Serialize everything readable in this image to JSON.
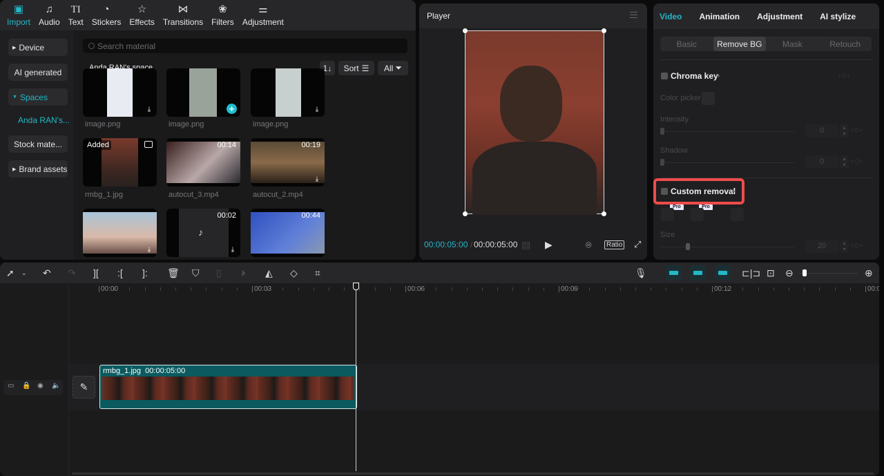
{
  "media_tabs": [
    {
      "label": "Import",
      "icon": "import-icon",
      "active": true
    },
    {
      "label": "Audio",
      "icon": "audio-icon"
    },
    {
      "label": "Text",
      "icon": "text-icon"
    },
    {
      "label": "Stickers",
      "icon": "stickers-icon"
    },
    {
      "label": "Effects",
      "icon": "effects-icon"
    },
    {
      "label": "Transitions",
      "icon": "transitions-icon"
    },
    {
      "label": "Filters",
      "icon": "filters-icon"
    },
    {
      "label": "Adjustment",
      "icon": "adjustment-icon"
    }
  ],
  "sidebar": {
    "device": "Device",
    "ai_generated": "AI generated",
    "spaces": "Spaces",
    "space_link": "Anda RAN's...",
    "stock": "Stock mate...",
    "brand": "Brand assets"
  },
  "search": {
    "placeholder": "Search material"
  },
  "space_title": "Anda RAN's space",
  "toolbar": {
    "order": "1↓",
    "sort": "Sort",
    "all": "All"
  },
  "cards": [
    {
      "name": "image.png",
      "download": true
    },
    {
      "name": "image.png",
      "add": true
    },
    {
      "name": "image.png",
      "download": true
    },
    {
      "name": "rmbg_1.jpg",
      "badge": "Added"
    },
    {
      "name": "autocut_3.mp4",
      "duration": "00:14"
    },
    {
      "name": "autocut_2.mp4",
      "duration": "00:19",
      "download": true
    },
    {
      "name": "",
      "download": true
    },
    {
      "name": "",
      "duration": "00:02",
      "download": true
    },
    {
      "name": "",
      "duration": "00:44"
    }
  ],
  "player": {
    "title": "Player",
    "current_time": "00:00:05:00",
    "total_time": "00:00:05:00",
    "ratio": "Ratio"
  },
  "props": {
    "tabs": [
      "Video",
      "Animation",
      "Adjustment",
      "AI stylize"
    ],
    "active_tab": "Video",
    "subtabs": [
      "Basic",
      "Remove BG",
      "Mask",
      "Retouch"
    ],
    "active_subtab": "Remove BG",
    "chroma_key": "Chroma key",
    "color_picker": "Color picker",
    "intensity": {
      "label": "Intensity",
      "value": "0"
    },
    "shadow": {
      "label": "Shadow",
      "value": "0"
    },
    "custom_removal": "Custom removal",
    "pro_badge": "Pro",
    "size": {
      "label": "Size",
      "value": "20"
    }
  },
  "timeline": {
    "ruler": [
      "00:00",
      "00:03",
      "00:06",
      "00:09",
      "00:12",
      "00:0"
    ],
    "clip": {
      "name": "rmbg_1.jpg",
      "duration": "00:00:05:00"
    }
  },
  "colors": {
    "accent": "#22b8c8",
    "highlight": "#ef4b4b"
  }
}
